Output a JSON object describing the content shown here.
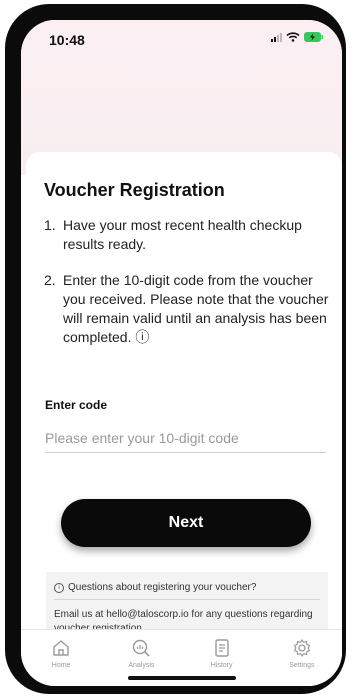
{
  "status_bar": {
    "time": "10:48"
  },
  "card": {
    "title": "Voucher Registration",
    "steps": [
      {
        "number": "1.",
        "text": "Have your most recent health checkup results ready."
      },
      {
        "number": "2.",
        "text": "Enter the 10-digit code from the voucher you received. Please note that the voucher will remain valid until an analysis has been completed. ⓘ"
      }
    ],
    "code_label": "Enter code",
    "code_input": {
      "value": "",
      "placeholder": "Please enter your 10-digit code"
    },
    "next_label": "Next"
  },
  "help": {
    "question": "Questions about registering your voucher?",
    "answer": "Email us at hello@taloscorp.io for any questions regarding voucher registration."
  },
  "tabs": [
    {
      "label": "Home",
      "icon": "home-icon"
    },
    {
      "label": "Analysis",
      "icon": "analysis-icon"
    },
    {
      "label": "History",
      "icon": "history-icon"
    },
    {
      "label": "Settings",
      "icon": "settings-icon"
    }
  ],
  "colors": {
    "accent": "#0a0a0a",
    "header_tint": "#fbeff2",
    "battery": "#34c759"
  }
}
